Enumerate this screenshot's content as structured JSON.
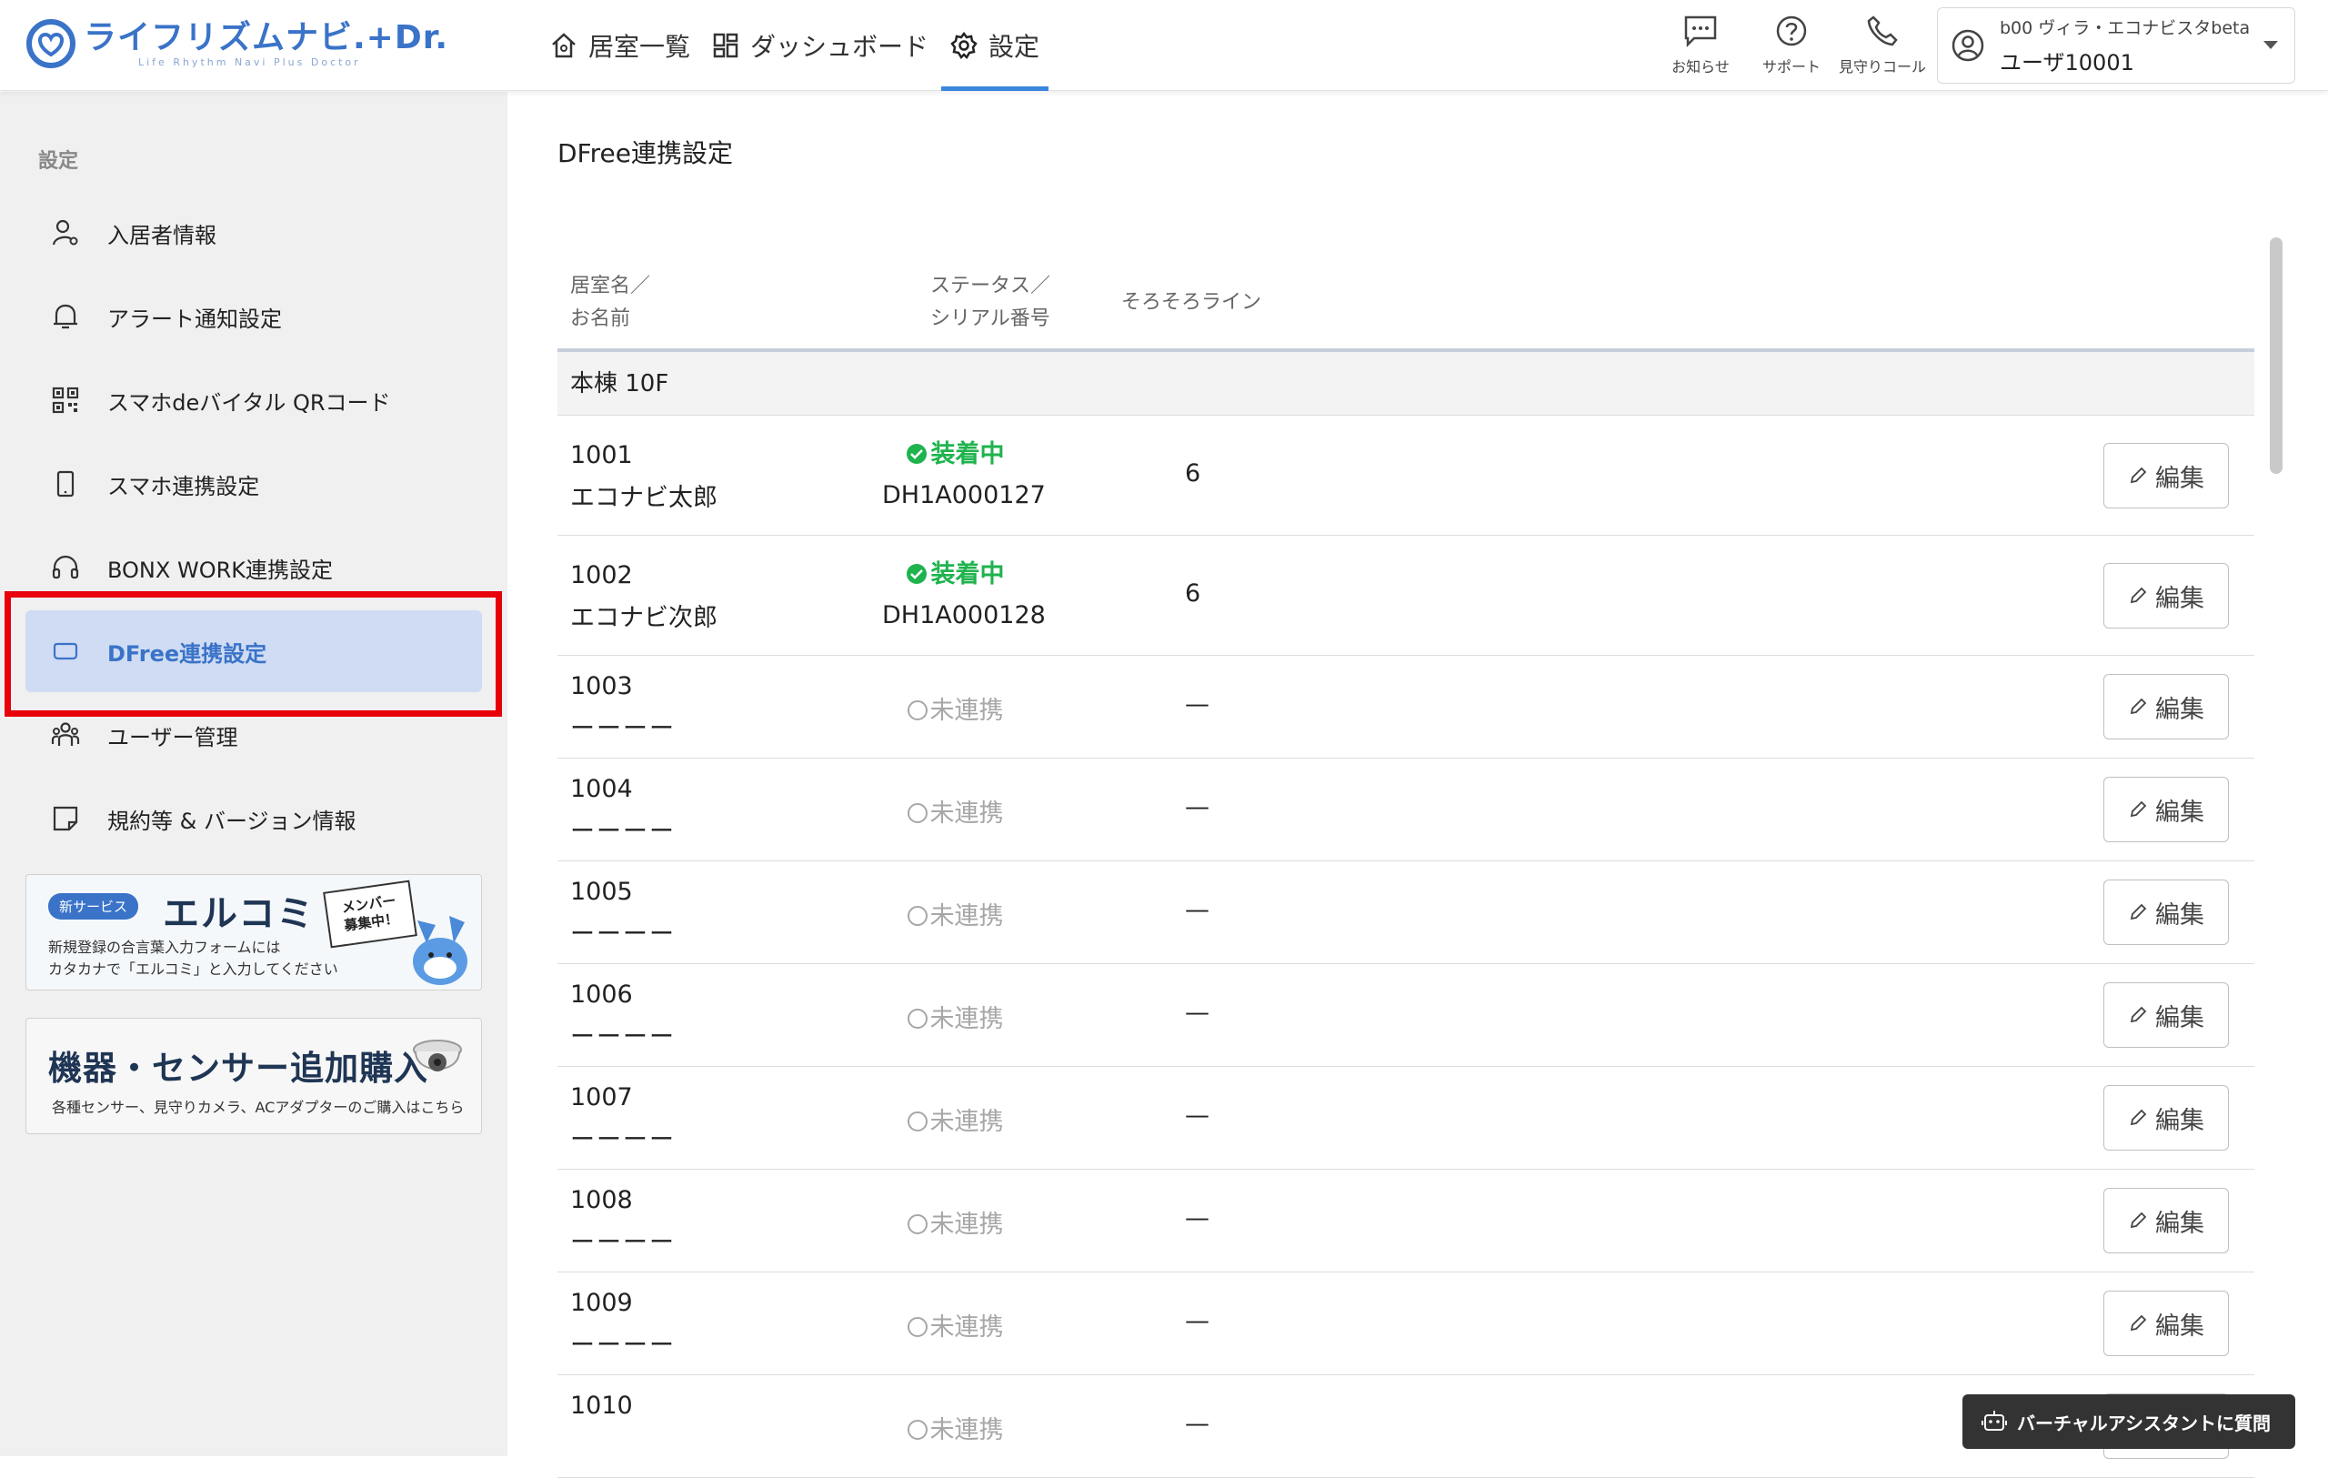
{
  "header": {
    "logo_main": "ライフリズムナビ.+Dr.",
    "logo_sub": "Life Rhythm Navi  Plus Doctor",
    "nav": [
      {
        "label": "居室一覧",
        "icon": "home-icon"
      },
      {
        "label": "ダッシュボード",
        "icon": "dashboard-icon"
      },
      {
        "label": "設定",
        "icon": "gear-icon",
        "active": true
      }
    ],
    "icons": [
      {
        "label": "お知らせ",
        "icon": "message-icon"
      },
      {
        "label": "サポート",
        "icon": "help-icon"
      },
      {
        "label": "見守りコール",
        "icon": "phone-icon"
      }
    ],
    "account": {
      "facility": "b00 ヴィラ・エコナビスタbeta",
      "user": "ユーザ10001"
    }
  },
  "sidebar": {
    "section": "設定",
    "items": [
      {
        "label": "入居者情報",
        "icon": "resident-icon"
      },
      {
        "label": "アラート通知設定",
        "icon": "bell-icon"
      },
      {
        "label": "スマホdeバイタル QRコード",
        "icon": "qr-icon"
      },
      {
        "label": "スマホ連携設定",
        "icon": "smartphone-icon"
      },
      {
        "label": "BONX WORK連携設定",
        "icon": "headset-icon"
      },
      {
        "label": "DFree連携設定",
        "icon": "dfree-icon",
        "active": true
      },
      {
        "label": "ユーザー管理",
        "icon": "users-icon"
      },
      {
        "label": "規約等 & バージョン情報",
        "icon": "note-icon"
      }
    ],
    "banner1": {
      "badge": "新サービス",
      "title": "エルコミ",
      "line1": "新規登録の合言葉入力フォームには",
      "line2": "カタカナで「エルコミ」と入力してください",
      "sign": "メンバー\n募集中！"
    },
    "banner2": {
      "title": "機器・センサー追加購入",
      "sub": "各種センサー、見守りカメラ、ACアダプターのご購入はこちら"
    }
  },
  "main": {
    "title": "DFree連携設定",
    "columns": {
      "room_name": [
        "居室名／",
        "お名前"
      ],
      "status_serial": [
        "ステータス／",
        "シリアル番号"
      ],
      "line": "そろそろライン"
    },
    "group": "本棟 10F",
    "edit_label": "編集",
    "rows": [
      {
        "room": "1001",
        "name": "エコナビ太郎",
        "status": "装着中",
        "connected": true,
        "serial": "DH1A000127",
        "line": "6"
      },
      {
        "room": "1002",
        "name": "エコナビ次郎",
        "status": "装着中",
        "connected": true,
        "serial": "DH1A000128",
        "line": "6"
      },
      {
        "room": "1003",
        "name": "ーーーー",
        "status": "未連携",
        "connected": false,
        "serial": "",
        "line": "—"
      },
      {
        "room": "1004",
        "name": "ーーーー",
        "status": "未連携",
        "connected": false,
        "serial": "",
        "line": "—"
      },
      {
        "room": "1005",
        "name": "ーーーー",
        "status": "未連携",
        "connected": false,
        "serial": "",
        "line": "—"
      },
      {
        "room": "1006",
        "name": "ーーーー",
        "status": "未連携",
        "connected": false,
        "serial": "",
        "line": "—"
      },
      {
        "room": "1007",
        "name": "ーーーー",
        "status": "未連携",
        "connected": false,
        "serial": "",
        "line": "—"
      },
      {
        "room": "1008",
        "name": "ーーーー",
        "status": "未連携",
        "connected": false,
        "serial": "",
        "line": "—"
      },
      {
        "room": "1009",
        "name": "ーーーー",
        "status": "未連携",
        "connected": false,
        "serial": "",
        "line": "—"
      },
      {
        "room": "1010",
        "name": "",
        "status": "未連携",
        "connected": false,
        "serial": "",
        "line": "—"
      }
    ]
  },
  "assistant": {
    "label": "バーチャルアシスタントに質問",
    "icon": "robot-icon"
  },
  "colors": {
    "accent": "#3a73c8",
    "active_bg": "#cfdcf3",
    "connected": "#1fb34e",
    "highlight": "#e8000b"
  }
}
